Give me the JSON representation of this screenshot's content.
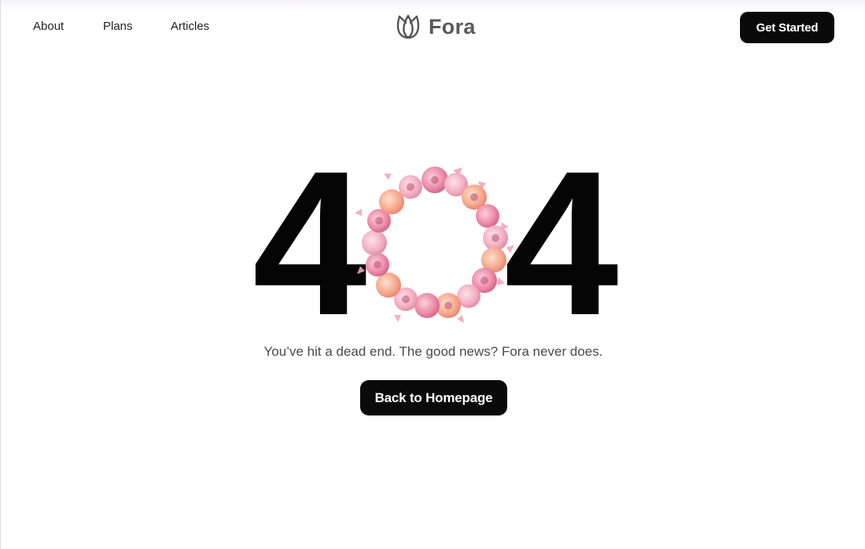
{
  "nav": {
    "links": [
      {
        "label": "About"
      },
      {
        "label": "Plans"
      },
      {
        "label": "Articles"
      }
    ],
    "logo_text": "Fora",
    "logo_icon": "tulip-icon",
    "cta_label": "Get Started"
  },
  "hero": {
    "digit_left": "4",
    "digit_right": "4",
    "center_image": "flower-wreath",
    "message": "You’ve hit a dead end. The good news? Fora never does.",
    "button_label": "Back to Homepage"
  },
  "colors": {
    "background": "#ffffff",
    "primary": "#0a0a0a",
    "text_muted": "#4a4a4a",
    "accent_pink": "#e8799a",
    "accent_peach": "#f4a58a"
  }
}
